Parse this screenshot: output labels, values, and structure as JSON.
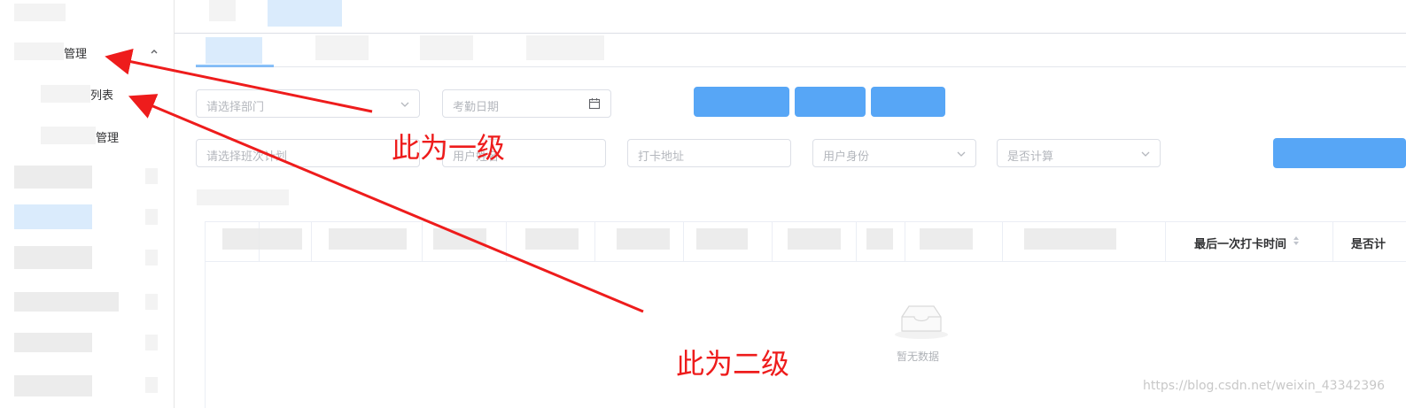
{
  "sidebar": {
    "menu1_label": "管理",
    "menu1_sub1_label": "列表",
    "menu1_sub2_label": "管理"
  },
  "filters": {
    "department_placeholder": "请选择部门",
    "date_placeholder": "考勤日期",
    "plan_placeholder": "请选择班次计划",
    "username_placeholder": "用户姓名",
    "address_placeholder": "打卡地址",
    "identity_placeholder": "用户身份",
    "calc_placeholder": "是否计算"
  },
  "table": {
    "columns": [
      "最后一次打卡时间",
      "是否计"
    ],
    "empty_text": "暂无数据"
  },
  "annotations": {
    "level1": "此为一级",
    "level2": "此为二级",
    "color": "#ee1c1c"
  },
  "watermark": "https://blog.csdn.net/weixin_43342396",
  "colors": {
    "accent": "#3a97f5",
    "border": "#dcdfe6"
  },
  "icons": [
    "chevron-up-icon",
    "chevron-down-icon",
    "calendar-icon",
    "sort-icon",
    "empty-box-icon"
  ]
}
